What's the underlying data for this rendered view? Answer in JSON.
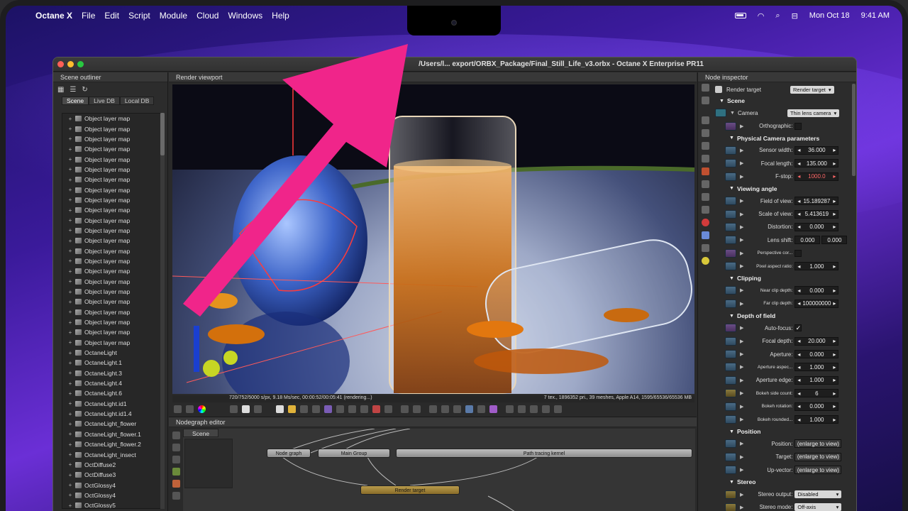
{
  "menubar": {
    "apple_icon": "apple-icon",
    "app_name": "Octane X",
    "items": [
      "File",
      "Edit",
      "Script",
      "Module",
      "Cloud",
      "Windows",
      "Help"
    ],
    "date": "Mon Oct 18",
    "time": "9:41 AM"
  },
  "window": {
    "title": "/Users/l... export/ORBX_Package/Final_Still_Life_v3.orbx - Octane X Enterprise PR11"
  },
  "outliner": {
    "header": "Scene outliner",
    "tabs": [
      "Scene",
      "Live DB",
      "Local DB"
    ],
    "items": [
      "Object layer map",
      "Object layer map",
      "Object layer map",
      "Object layer map",
      "Object layer map",
      "Object layer map",
      "Object layer map",
      "Object layer map",
      "Object layer map",
      "Object layer map",
      "Object layer map",
      "Object layer map",
      "Object layer map",
      "Object layer map",
      "Object layer map",
      "Object layer map",
      "Object layer map",
      "Object layer map",
      "Object layer map",
      "Object layer map",
      "Object layer map",
      "Object layer map",
      "Object layer map",
      "OctaneLight",
      "OctaneLight.1",
      "OctaneLight.3",
      "OctaneLight.4",
      "OctaneLight.6",
      "OctaneLight.id1",
      "OctaneLight.id1.4",
      "OctaneLight_flower",
      "OctaneLight_flower.1",
      "OctaneLight_flower.2",
      "OctaneLight_insect",
      "OctDiffuse2",
      "OctDiffuse3",
      "OctGlossy4",
      "OctGlossy4",
      "OctGlossy5"
    ]
  },
  "viewport": {
    "header": "Render viewport",
    "status_left": "720/752/5000 s/px, 9.18 Ms/sec, 00:00:52/00:05:41 (rendering...)",
    "status_right": "7 tex., 1896352 pri., 39 meshes, Apple A14, 1595/65536/65536 MB"
  },
  "nodegraph": {
    "header": "Nodegraph editor",
    "tab": "Scene",
    "nodes": {
      "node_graph": "Node graph",
      "main_group": "Main Group",
      "path_tracing": "Path tracing kernel",
      "render_target": "Render target"
    }
  },
  "inspector": {
    "header": "Node inspector",
    "render_target_label": "Render target",
    "render_target_value": "Render target",
    "scene_section": "Scene",
    "camera_label": "Camera",
    "camera_value": "Thin lens camera",
    "orthographic_label": "Orthographic:",
    "physical_section": "Physical Camera parameters",
    "sensor_width_label": "Sensor width:",
    "sensor_width": "36.000",
    "focal_length_label": "Focal length:",
    "focal_length": "135.000",
    "fstop_label": "F-stop:",
    "fstop": "1000.0",
    "viewing_section": "Viewing angle",
    "fov_label": "Field of view:",
    "fov": "15.189287",
    "scale_label": "Scale of view:",
    "scale": "5.413619",
    "distortion_label": "Distortion:",
    "distortion": "0.000",
    "lens_shift_label": "Lens shift:",
    "lens_shift_x": "0.000",
    "lens_shift_y": "0.000",
    "persp_label": "Perspective cor...",
    "pixel_aspect_label": "Pixel aspect ratio:",
    "pixel_aspect": "1.000",
    "clipping_section": "Clipping",
    "near_clip_label": "Near clip depth:",
    "near_clip": "0.000",
    "far_clip_label": "Far clip depth:",
    "far_clip": "100000000",
    "dof_section": "Depth of field",
    "autofocus_label": "Auto-focus:",
    "autofocus_check": "✓",
    "focal_depth_label": "Focal depth:",
    "focal_depth": "20.000",
    "aperture_label": "Aperture:",
    "aperture": "0.000",
    "aperture_aspect_label": "Aperture aspec...",
    "aperture_aspect": "1.000",
    "aperture_edge_label": "Aperture edge:",
    "aperture_edge": "1.000",
    "bokeh_side_label": "Bokeh side count:",
    "bokeh_side": "6",
    "bokeh_rot_label": "Bokeh rotation:",
    "bokeh_rot": "0.000",
    "bokeh_round_label": "Bokeh rounded...",
    "bokeh_round": "1.000",
    "position_section": "Position",
    "position_label": "Position:",
    "target_label": "Target:",
    "upvector_label": "Up-vector:",
    "enlarge": "(enlarge to view)",
    "stereo_section": "Stereo",
    "stereo_output_label": "Stereo output:",
    "stereo_output": "Disabled",
    "stereo_mode_label": "Stereo mode:",
    "stereo_mode": "Off-axis"
  },
  "colors": {
    "annotation_arrow": "#f0258a"
  }
}
